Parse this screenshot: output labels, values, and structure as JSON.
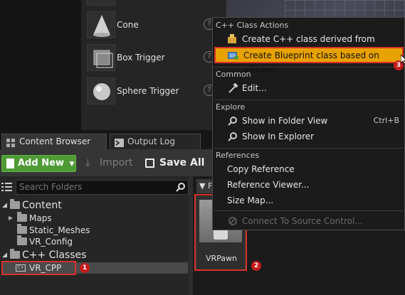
{
  "place_panel": {
    "items": [
      {
        "label": "Cone",
        "icon": "cone-icon"
      },
      {
        "label": "Box Trigger",
        "icon": "box-trigger-icon"
      },
      {
        "label": "Sphere Trigger",
        "icon": "sphere-trigger-icon"
      }
    ],
    "help_glyph": "?"
  },
  "tabs": [
    {
      "label": "Content Browser",
      "icon": "content-browser-icon"
    },
    {
      "label": "Output Log",
      "icon": "output-log-icon"
    }
  ],
  "toolbar": {
    "add_new_label": "Add New",
    "import_label": "Import",
    "save_all_label": "Save All",
    "accent_color": "#4e9b36"
  },
  "folder_tree": {
    "search_placeholder": "Search Folders",
    "content_root": "Content",
    "content_children": [
      "Maps",
      "Static_Meshes",
      "VR_Config"
    ],
    "cpp_root": "C++ Classes",
    "cpp_children": [
      "VR_CPP"
    ]
  },
  "asset_view": {
    "filter_label": "F",
    "asset_name": "VRPawn"
  },
  "context_menu": {
    "sections": {
      "cpp_actions": "C++ Class Actions",
      "common": "Common",
      "explore": "Explore",
      "references": "References"
    },
    "items": {
      "create_cpp": "Create C++ class derived from VRPawn",
      "create_blueprint": "Create Blueprint class based on VRPawn",
      "edit": "Edit...",
      "show_folder": "Show in Folder View",
      "show_folder_shortcut": "Ctrl+B",
      "show_explorer": "Show In Explorer",
      "copy_reference": "Copy Reference",
      "reference_viewer": "Reference Viewer...",
      "size_map": "Size Map...",
      "connect_source": "Connect To Source Control..."
    },
    "highlight_color": "#e8a200"
  },
  "annotations": {
    "marker_1": "1",
    "marker_2": "2",
    "marker_3": "3",
    "color": "#d9302c"
  }
}
